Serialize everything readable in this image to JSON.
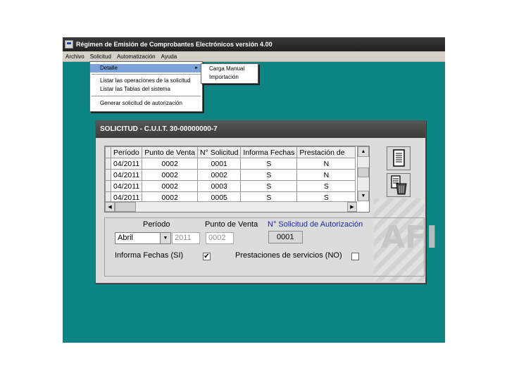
{
  "window": {
    "title": "Régimen de Emisión de Comprobantes Electrónicos versión 4.00"
  },
  "menubar": {
    "items": [
      "Archivo",
      "Solicitud",
      "Automatización",
      "Ayuda"
    ]
  },
  "dropdown": {
    "items": [
      "Detalle",
      "Listar las operaciones de la solicitud",
      "Listar las Tablas del sistema",
      "Generar solicitud de autorización"
    ],
    "selected": "Detalle",
    "submenu": [
      "Carga Manual",
      "Importación"
    ]
  },
  "dialog": {
    "title": "SOLICITUD - C.U.I.T. 30-00000000-7",
    "grid": {
      "columns": [
        "Período",
        "Punto de Venta",
        "N° Solicitud",
        "Informa Fechas",
        "Prestación de"
      ],
      "rows": [
        [
          "04/2011",
          "0002",
          "0001",
          "S",
          "N"
        ],
        [
          "04/2011",
          "0002",
          "0002",
          "S",
          "N"
        ],
        [
          "04/2011",
          "0002",
          "0003",
          "S",
          "S"
        ],
        [
          "04/2011",
          "0002",
          "0005",
          "S",
          "S"
        ]
      ]
    },
    "form": {
      "periodo_label": "Período",
      "punto_label": "Punto de Venta",
      "nro_label": "N° Solicitud de Autorización",
      "month": "Abril",
      "year": "2011",
      "punto_value": "0002",
      "nro_value": "0001",
      "informa_label": "Informa Fechas (SI)",
      "informa_checked": "✔",
      "prestaciones_label": "Prestaciones de servicios (NO)",
      "prestaciones_checked": ""
    },
    "watermark": "AFI"
  },
  "colors": {
    "desktop": "#0c8484",
    "menu_highlight": "#7ba3d9",
    "link_blue": "#1a2a9a"
  }
}
